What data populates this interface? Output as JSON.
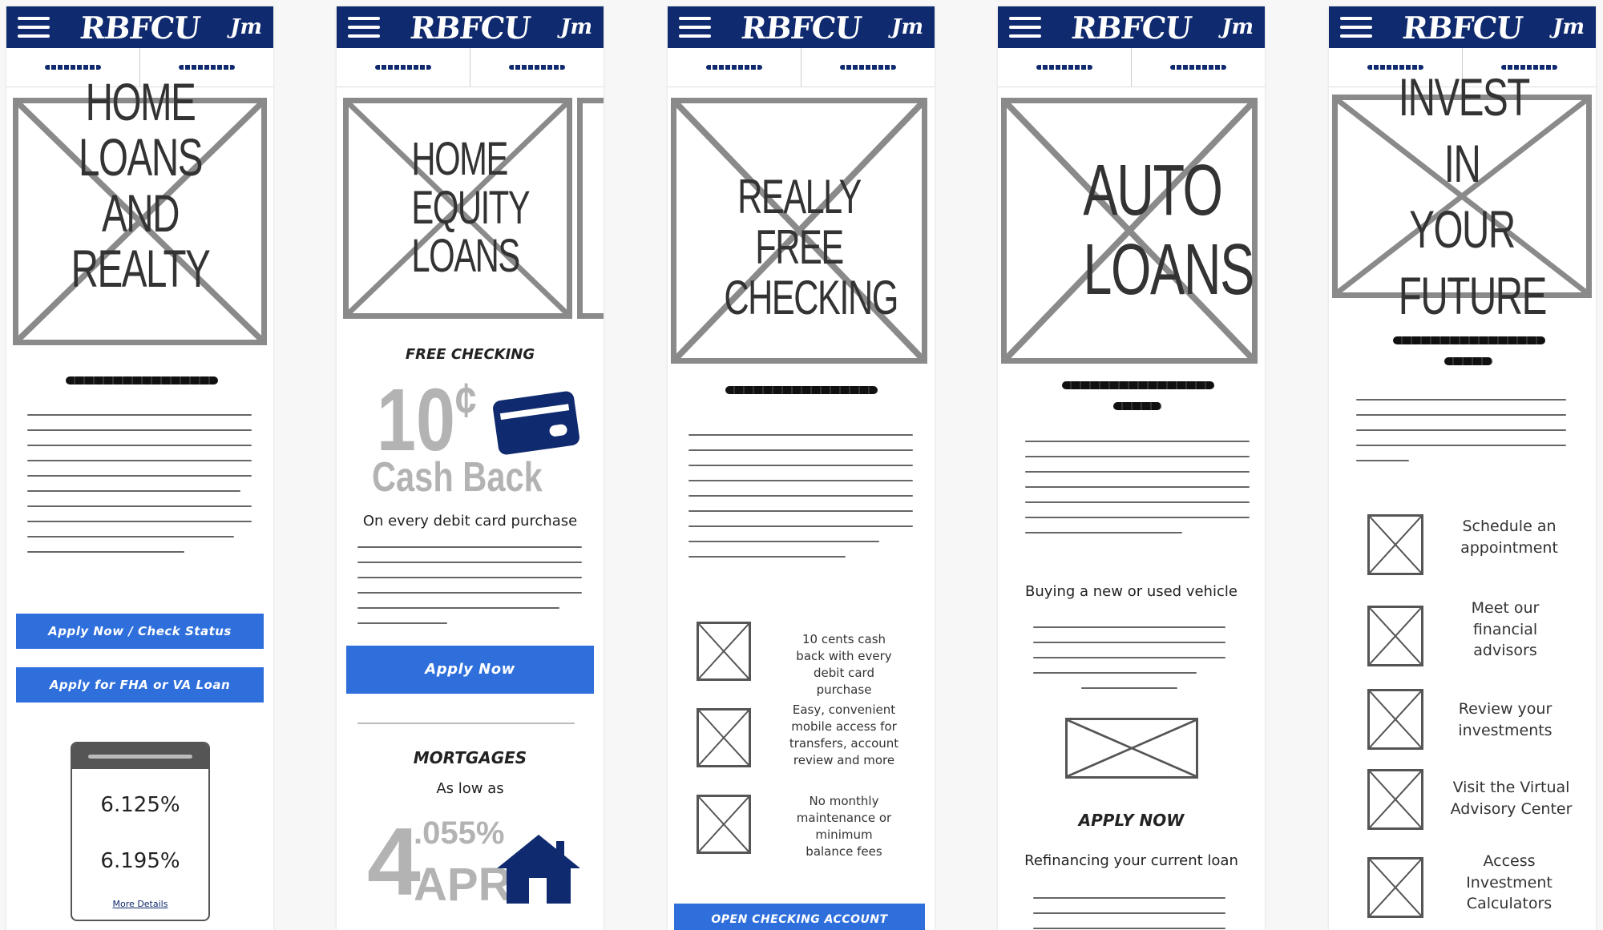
{
  "common": {
    "brand": "RBFCU",
    "signature": "Jm"
  },
  "screen1": {
    "hero": "HOME LOANS AND REALTY",
    "buttons": [
      "Apply Now / Check Status",
      "Apply for FHA or VA Loan"
    ],
    "rates": [
      "6.125%",
      "6.195%"
    ],
    "more_details": "More Details"
  },
  "screen2": {
    "hero": "HOME EQUITY LOANS",
    "section1_title": "FREE CHECKING",
    "promo_big": "10",
    "promo_cent": "¢",
    "promo_cashback": "Cash Back",
    "promo_caption": "On every debit card purchase",
    "apply_button": "Apply Now",
    "section2_title": "MORTGAGES",
    "as_low_as": "As low as",
    "rate_int": "4",
    "rate_frac": ".055%",
    "rate_apr": "APR"
  },
  "screen3": {
    "hero": "REALLY FREE CHECKING",
    "features": [
      "10 cents cash back with every debit card purchase",
      "Easy, convenient mobile access for transfers, account review and more",
      "No monthly maintenance or minimum balance fees"
    ],
    "open_button": "OPEN CHECKING ACCOUNT"
  },
  "screen4": {
    "hero": "AUTO LOANS",
    "subheading1": "Buying a new or used vehicle",
    "apply": "APPLY NOW",
    "subheading2": "Refinancing your current loan"
  },
  "screen5": {
    "hero": "INVEST IN YOUR FUTURE",
    "items": [
      "Schedule an appointment",
      "Meet our financial advisors",
      "Review your investments",
      "Visit the Virtual Advisory Center",
      "Access Investment Calculators"
    ]
  },
  "colors": {
    "navy": "#0f2a6e",
    "button": "#2f6fdc",
    "gray": "#8a8a8a"
  }
}
